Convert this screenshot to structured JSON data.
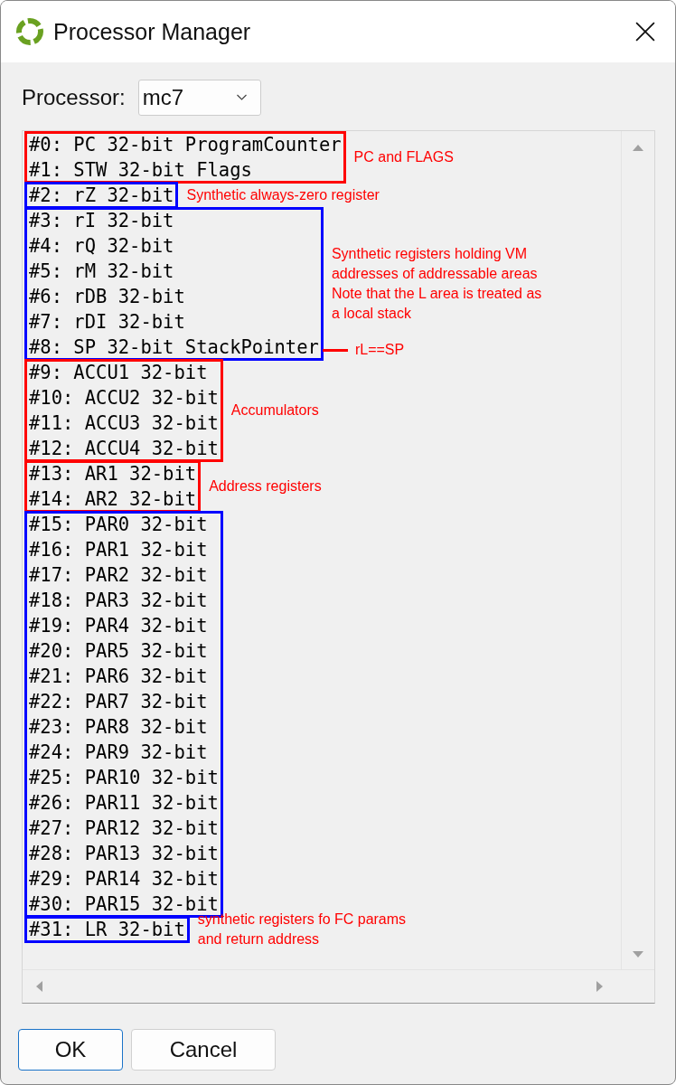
{
  "window": {
    "title": "Processor Manager"
  },
  "processor": {
    "label": "Processor:",
    "value": "mc7"
  },
  "groups": [
    {
      "color": "#ff0000",
      "rows": [
        "#0: PC 32-bit ProgramCounter",
        "#1: STW 32-bit Flags"
      ],
      "note": "PC and FLAGS"
    },
    {
      "color": "#0000ff",
      "rows": [
        "#2: rZ 32-bit"
      ],
      "note": "Synthetic always-zero register"
    },
    {
      "color": "#0000ff",
      "rows": [
        "#3: rI 32-bit",
        "#4: rQ 32-bit",
        "#5: rM 32-bit",
        "#6: rDB 32-bit",
        "#7: rDI 32-bit",
        "#8: SP 32-bit StackPointer"
      ],
      "note": "Synthetic registers holding VM\naddresses of addressable areas\nNote that the L area is treated as\na local stack",
      "leader_label": "rL==SP"
    },
    {
      "color": "#ff0000",
      "rows": [
        "#9: ACCU1 32-bit",
        "#10: ACCU2 32-bit",
        "#11: ACCU3 32-bit",
        "#12: ACCU4 32-bit"
      ],
      "note": "Accumulators"
    },
    {
      "color": "#ff0000",
      "rows": [
        "#13: AR1 32-bit",
        "#14: AR2 32-bit"
      ],
      "note": "Address registers"
    },
    {
      "color": "#0000ff",
      "rows": [
        "#15: PAR0 32-bit",
        "#16: PAR1 32-bit",
        "#17: PAR2 32-bit",
        "#18: PAR3 32-bit",
        "#19: PAR4 32-bit",
        "#20: PAR5 32-bit",
        "#21: PAR6 32-bit",
        "#22: PAR7 32-bit",
        "#23: PAR8 32-bit",
        "#24: PAR9 32-bit",
        "#25: PAR10 32-bit",
        "#26: PAR11 32-bit",
        "#27: PAR12 32-bit",
        "#28: PAR13 32-bit",
        "#29: PAR14 32-bit",
        "#30: PAR15 32-bit"
      ]
    },
    {
      "color": "#0000ff",
      "rows": [
        "#31: LR 32-bit"
      ],
      "note": "synthetic registers fo FC params\nand return address"
    }
  ],
  "buttons": [
    {
      "label": "OK",
      "default": true
    },
    {
      "label": "Cancel",
      "default": false
    }
  ]
}
